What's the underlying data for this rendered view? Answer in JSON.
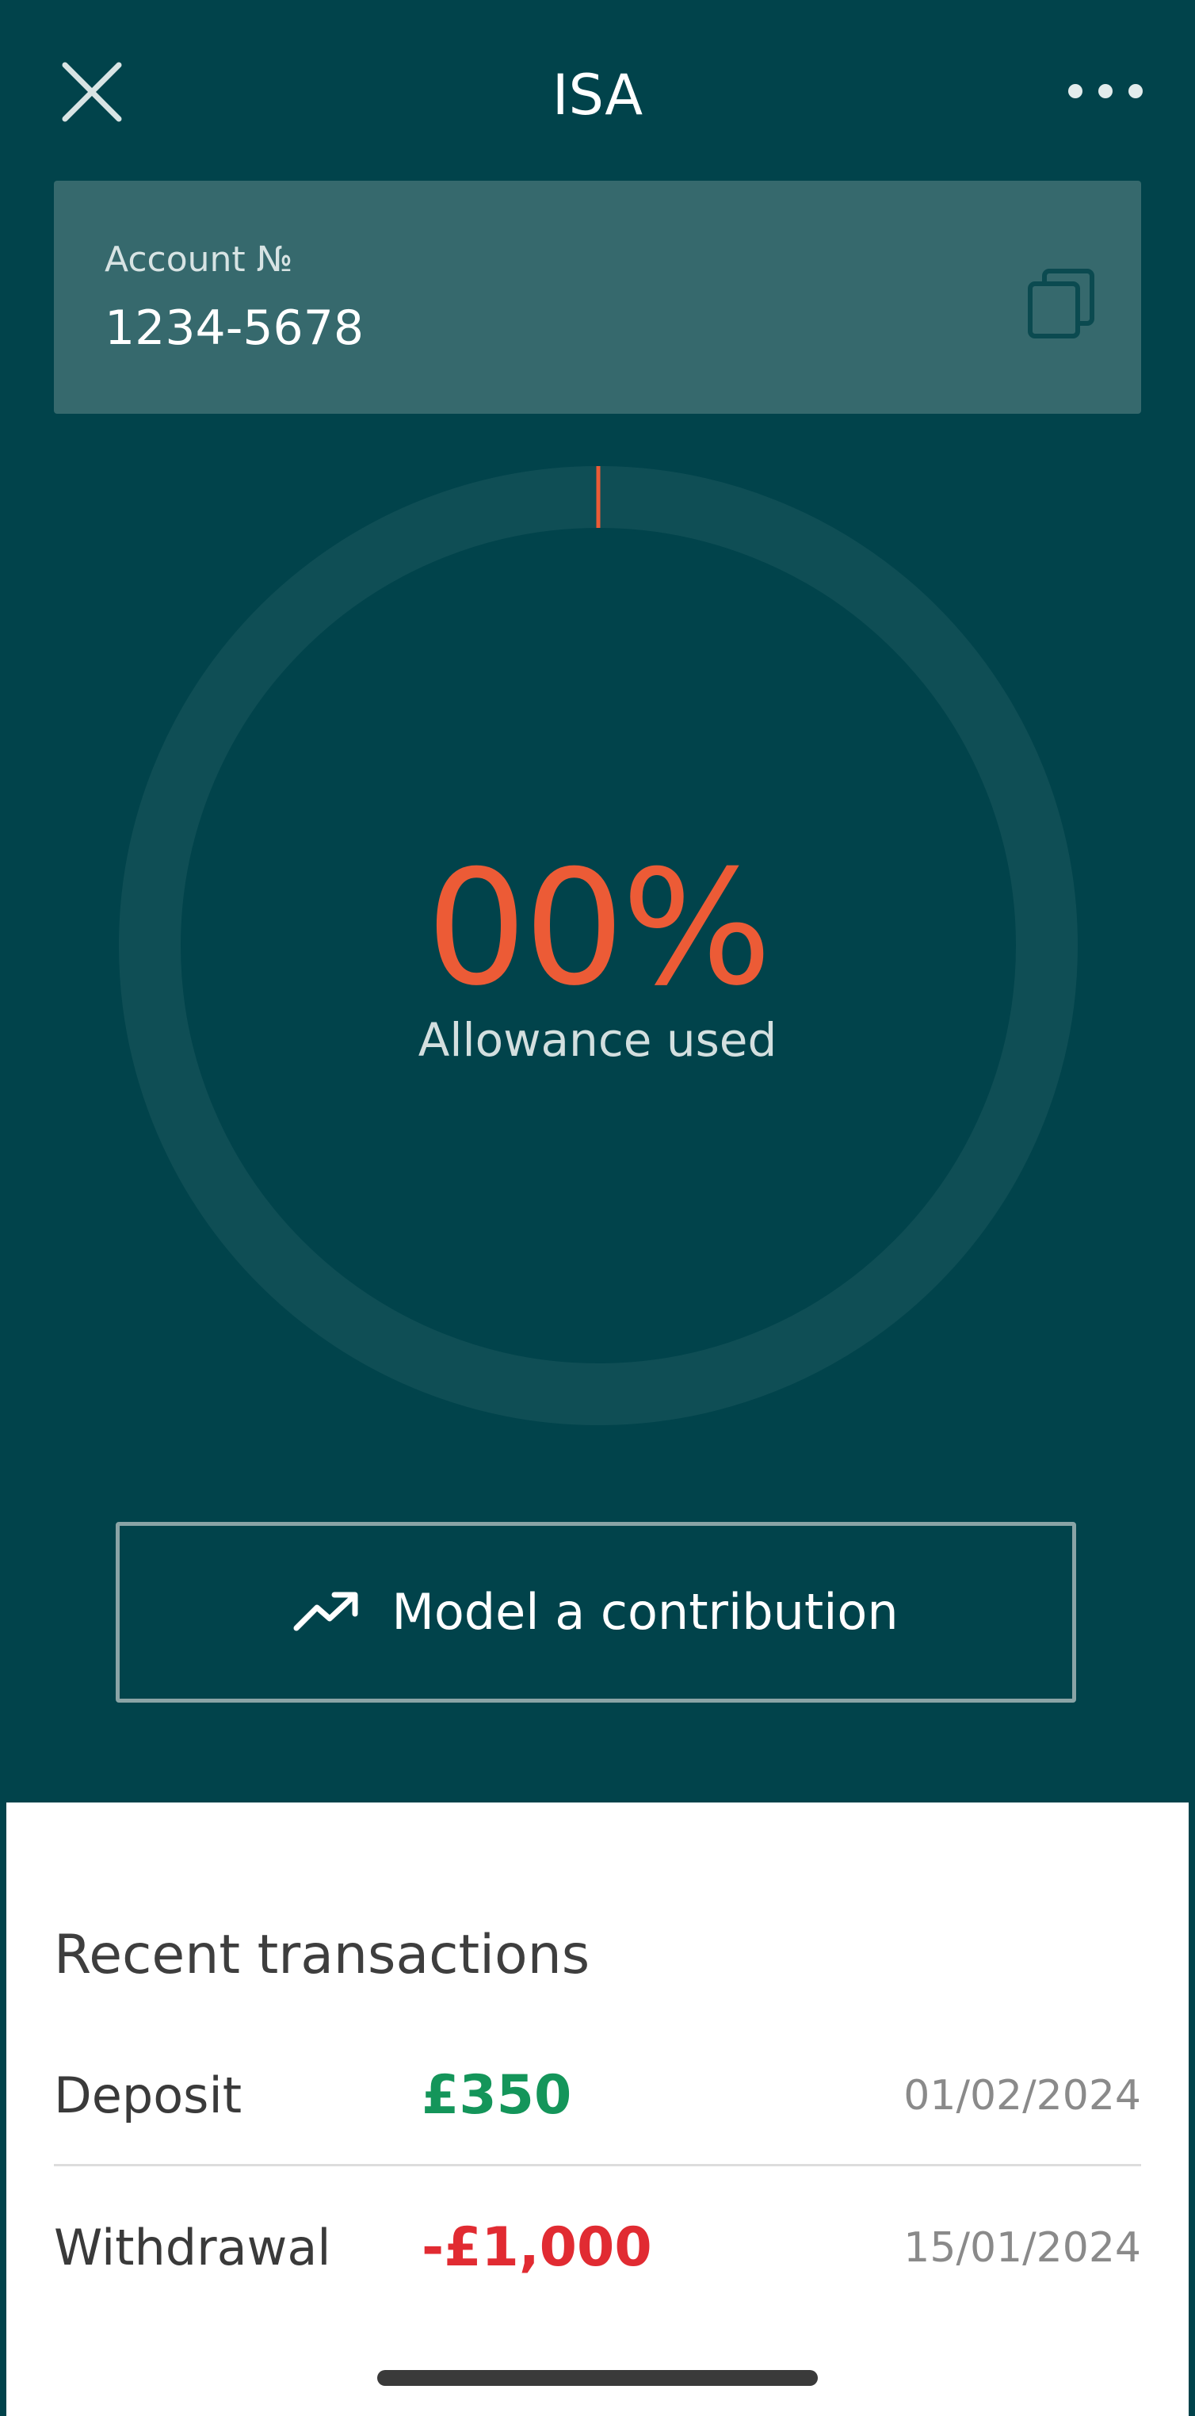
{
  "header": {
    "title": "ISA",
    "close_icon": "close-icon",
    "more_icon": "more-horizontal-icon"
  },
  "account": {
    "label": "Account №",
    "number": "1234-5678",
    "copy_icon": "copy-icon"
  },
  "allowance": {
    "value_text": "00%",
    "label": "Allowance used",
    "fraction_used": 0,
    "ring_color": "#0f4e55",
    "accent_color": "#ec5b36"
  },
  "model_button": {
    "label": "Model a contribution",
    "icon": "trending-up-icon"
  },
  "transactions": {
    "title": "Recent transactions",
    "items": [
      {
        "type": "Deposit",
        "amount": "£350",
        "date": "01/02/2024",
        "direction": "in"
      },
      {
        "type": "Withdrawal",
        "amount": "-£1,000",
        "date": "15/01/2024",
        "direction": "out"
      }
    ]
  },
  "colors": {
    "background": "#01434b",
    "card": "#36696d",
    "positive": "#14955a",
    "negative": "#e12b32"
  }
}
